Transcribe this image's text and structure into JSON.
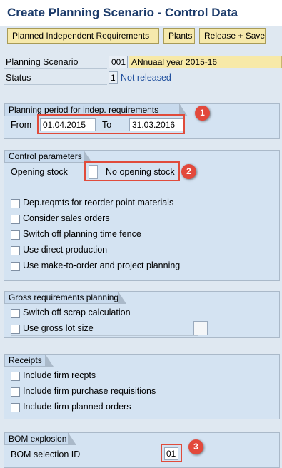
{
  "title": "Create Planning Scenario - Control Data",
  "toolbar": {
    "pir_label": "Planned Independent Requirements",
    "plants_label": "Plants",
    "release_label": "Release + Save"
  },
  "header": {
    "scenario_label": "Planning Scenario",
    "scenario_number": "001",
    "scenario_name": "ANnuaal year 2015-16",
    "status_label": "Status",
    "status_code": "1",
    "status_text": "Not released"
  },
  "planning_period": {
    "group_title": "Planning period for indep. requirements",
    "from_label": "From",
    "from_value": "01.04.2015",
    "to_label": "To",
    "to_value": "31.03.2016",
    "marker": "1"
  },
  "control_parameters": {
    "group_title": "Control parameters",
    "opening_stock_label": "Opening stock",
    "opening_stock_value": "",
    "opening_stock_text": "No opening stock",
    "marker": "2",
    "checkboxes": [
      {
        "label": "Dep.reqmts for reorder point materials",
        "checked": false
      },
      {
        "label": "Consider sales orders",
        "checked": false
      },
      {
        "label": "Switch off planning time fence",
        "checked": false
      },
      {
        "label": "Use direct production",
        "checked": false
      },
      {
        "label": "Use make-to-order and project planning",
        "checked": false
      }
    ]
  },
  "gross_requirements": {
    "group_title": "Gross requirements planning",
    "checkboxes": [
      {
        "label": "Switch off scrap calculation",
        "checked": false
      },
      {
        "label": "Use gross lot size",
        "checked": false
      }
    ],
    "gross_lot_value": ""
  },
  "receipts": {
    "group_title": "Receipts",
    "checkboxes": [
      {
        "label": "Include firm recpts",
        "checked": false
      },
      {
        "label": "Include firm purchase requisitions",
        "checked": false
      },
      {
        "label": "Include firm planned orders",
        "checked": false
      }
    ]
  },
  "bom_explosion": {
    "group_title": "BOM explosion",
    "selection_id_label": "BOM selection ID",
    "selection_id_value": "01",
    "marker": "3"
  },
  "colors": {
    "background": "#dfe8f1",
    "group_background": "#d4e3f2",
    "button": "#f6e9ac",
    "title": "#1c3b6a",
    "highlight": "#e04b3b",
    "status_link": "#1f4f9e"
  }
}
